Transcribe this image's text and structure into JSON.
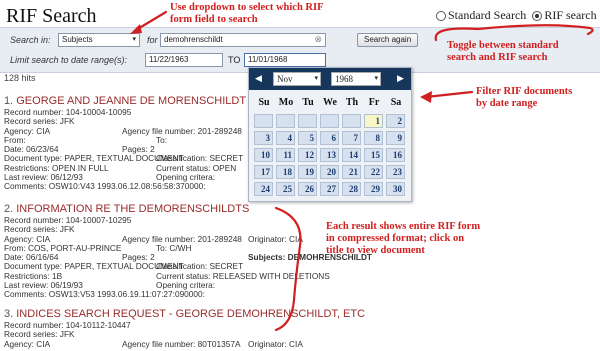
{
  "header": {
    "title": "RIF Search",
    "radio_standard": "Standard Search",
    "radio_rif": "RIF search"
  },
  "search": {
    "search_in_label": "Search in:",
    "field_select": "Subjects",
    "for_label": "for",
    "query": "demohrenschildt",
    "clear_icon": "x-circle-icon",
    "search_again": "Search again",
    "limit_label": "Limit search to date range(s):",
    "date_from": "11/22/1963",
    "to_label": "TO",
    "date_to": "11/01/1968"
  },
  "hits": "128 hits",
  "calendar": {
    "month": "Nov",
    "year": "1968",
    "weekdays": [
      "Su",
      "Mo",
      "Tu",
      "We",
      "Th",
      "Fr",
      "Sa"
    ],
    "weeks": [
      [
        "",
        "",
        "",
        "",
        "",
        "1",
        "2"
      ],
      [
        "3",
        "4",
        "5",
        "6",
        "7",
        "8",
        "9"
      ],
      [
        "10",
        "11",
        "12",
        "13",
        "14",
        "15",
        "16"
      ],
      [
        "17",
        "18",
        "19",
        "20",
        "21",
        "22",
        "23"
      ],
      [
        "24",
        "25",
        "26",
        "27",
        "28",
        "29",
        "30"
      ]
    ]
  },
  "results": [
    {
      "number": "1.",
      "title": "GEORGE AND JEANNE DE MORENSCHILDT",
      "lines": [
        [
          "Record number: 104-10004-10095"
        ],
        [
          "Record series: JFK"
        ],
        [
          "Agency: CIA",
          "Agency file number: 201-289248",
          "Originator: CIA"
        ],
        [
          "From:",
          "To:"
        ],
        [
          "Date: 06/23/64",
          "Pages: 2",
          "Subjects: DEMOHRENSCHILDT"
        ],
        [
          "Document type: PAPER, TEXTUAL DOCUMENT",
          "Classification: SECRET"
        ],
        [
          "Restrictions: OPEN IN FULL",
          "Current status: OPEN"
        ],
        [
          "Last review: 06/12/93",
          "Opening critera:"
        ],
        [
          "Comments: OSW10:V43 1993.06.12.08:56:58:370000:"
        ]
      ]
    },
    {
      "number": "2.",
      "title": "INFORMATION RE THE DEMORENSCHILDTS",
      "lines": [
        [
          "Record number: 104-10007-10295"
        ],
        [
          "Record series: JFK"
        ],
        [
          "Agency: CIA",
          "Agency file number: 201-289248",
          "Originator: CIA"
        ],
        [
          "From: COS, PORT-AU-PRINCE",
          "To: C/WH"
        ],
        [
          "Date: 06/16/64",
          "Pages: 2",
          "Subjects: DEMOHRENSCHILDT"
        ],
        [
          "Document type: PAPER, TEXTUAL DOCUMENT",
          "Classification: SECRET"
        ],
        [
          "Restrictions: 1B",
          "Current status: RELEASED WITH DELETIONS"
        ],
        [
          "Last review: 06/19/93",
          "Opening critera:"
        ],
        [
          "Comments: OSW13:V53 1993.06.19.11:07:27:090000:"
        ]
      ]
    },
    {
      "number": "3.",
      "title": "INDICES SEARCH REQUEST - GEORGE DEMOHRENSCHILDT, ETC",
      "lines": [
        [
          "Record number: 104-10112-10447"
        ],
        [
          "Record series: JFK"
        ],
        [
          "Agency: CIA",
          "Agency file number: 80T01357A",
          "Originator: CIA"
        ]
      ]
    }
  ],
  "annotations": {
    "a1": [
      "Use dropdown to select which RIF",
      "form field to search"
    ],
    "a2": [
      "Toggle between standard",
      "search and RIF search"
    ],
    "a3": [
      "Filter RIF documents",
      "by date range"
    ],
    "a4": [
      "Each result shows entire RIF form",
      "in compressed format; click on",
      "title to view document"
    ]
  },
  "colors": {
    "annotation": "#d02020",
    "calendar_header": "#16365c",
    "result_title": "#9a2b2b"
  }
}
